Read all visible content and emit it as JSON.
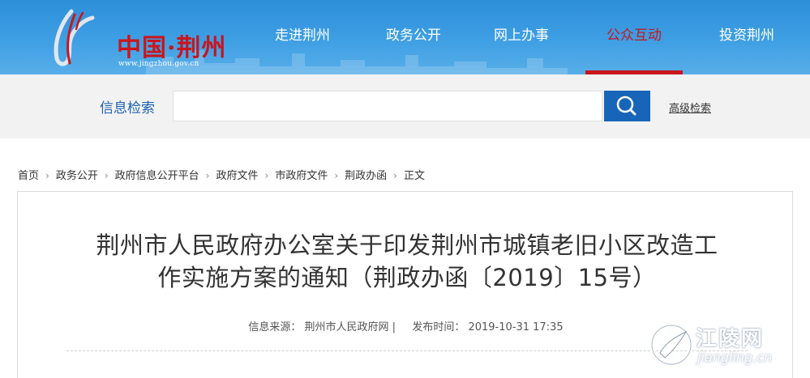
{
  "header": {
    "logo_text": "中国·荆州",
    "logo_url": "www.jingzhou.gov.cn",
    "nav": [
      {
        "label": "走进荆州",
        "active": false
      },
      {
        "label": "政务公开",
        "active": false
      },
      {
        "label": "网上办事",
        "active": false
      },
      {
        "label": "公众互动",
        "active": true
      },
      {
        "label": "投资荆州",
        "active": false
      }
    ],
    "accent_color": "#c8161d"
  },
  "search": {
    "label": "信息检索",
    "value": "",
    "placeholder": "",
    "button_icon": "search-icon",
    "advanced_label": "高级检索"
  },
  "breadcrumb": {
    "items": [
      "首页",
      "政务公开",
      "政府信息公开平台",
      "政府文件",
      "市政府文件",
      "荆政办函",
      "正文"
    ],
    "separator": "›"
  },
  "article": {
    "title_line1": "荆州市人民政府办公室关于印发荆州市城镇老旧小区改造工",
    "title_line2": "作实施方案的通知（荆政办函〔2019〕15号）",
    "source_label": "信息来源：",
    "source_value": "荆州市人民政府网 |",
    "date_label": "发布时间：",
    "date_value": "2019-10-31 17:35"
  },
  "watermark": {
    "text": "江陵网",
    "sub": "jiangling.cn"
  }
}
